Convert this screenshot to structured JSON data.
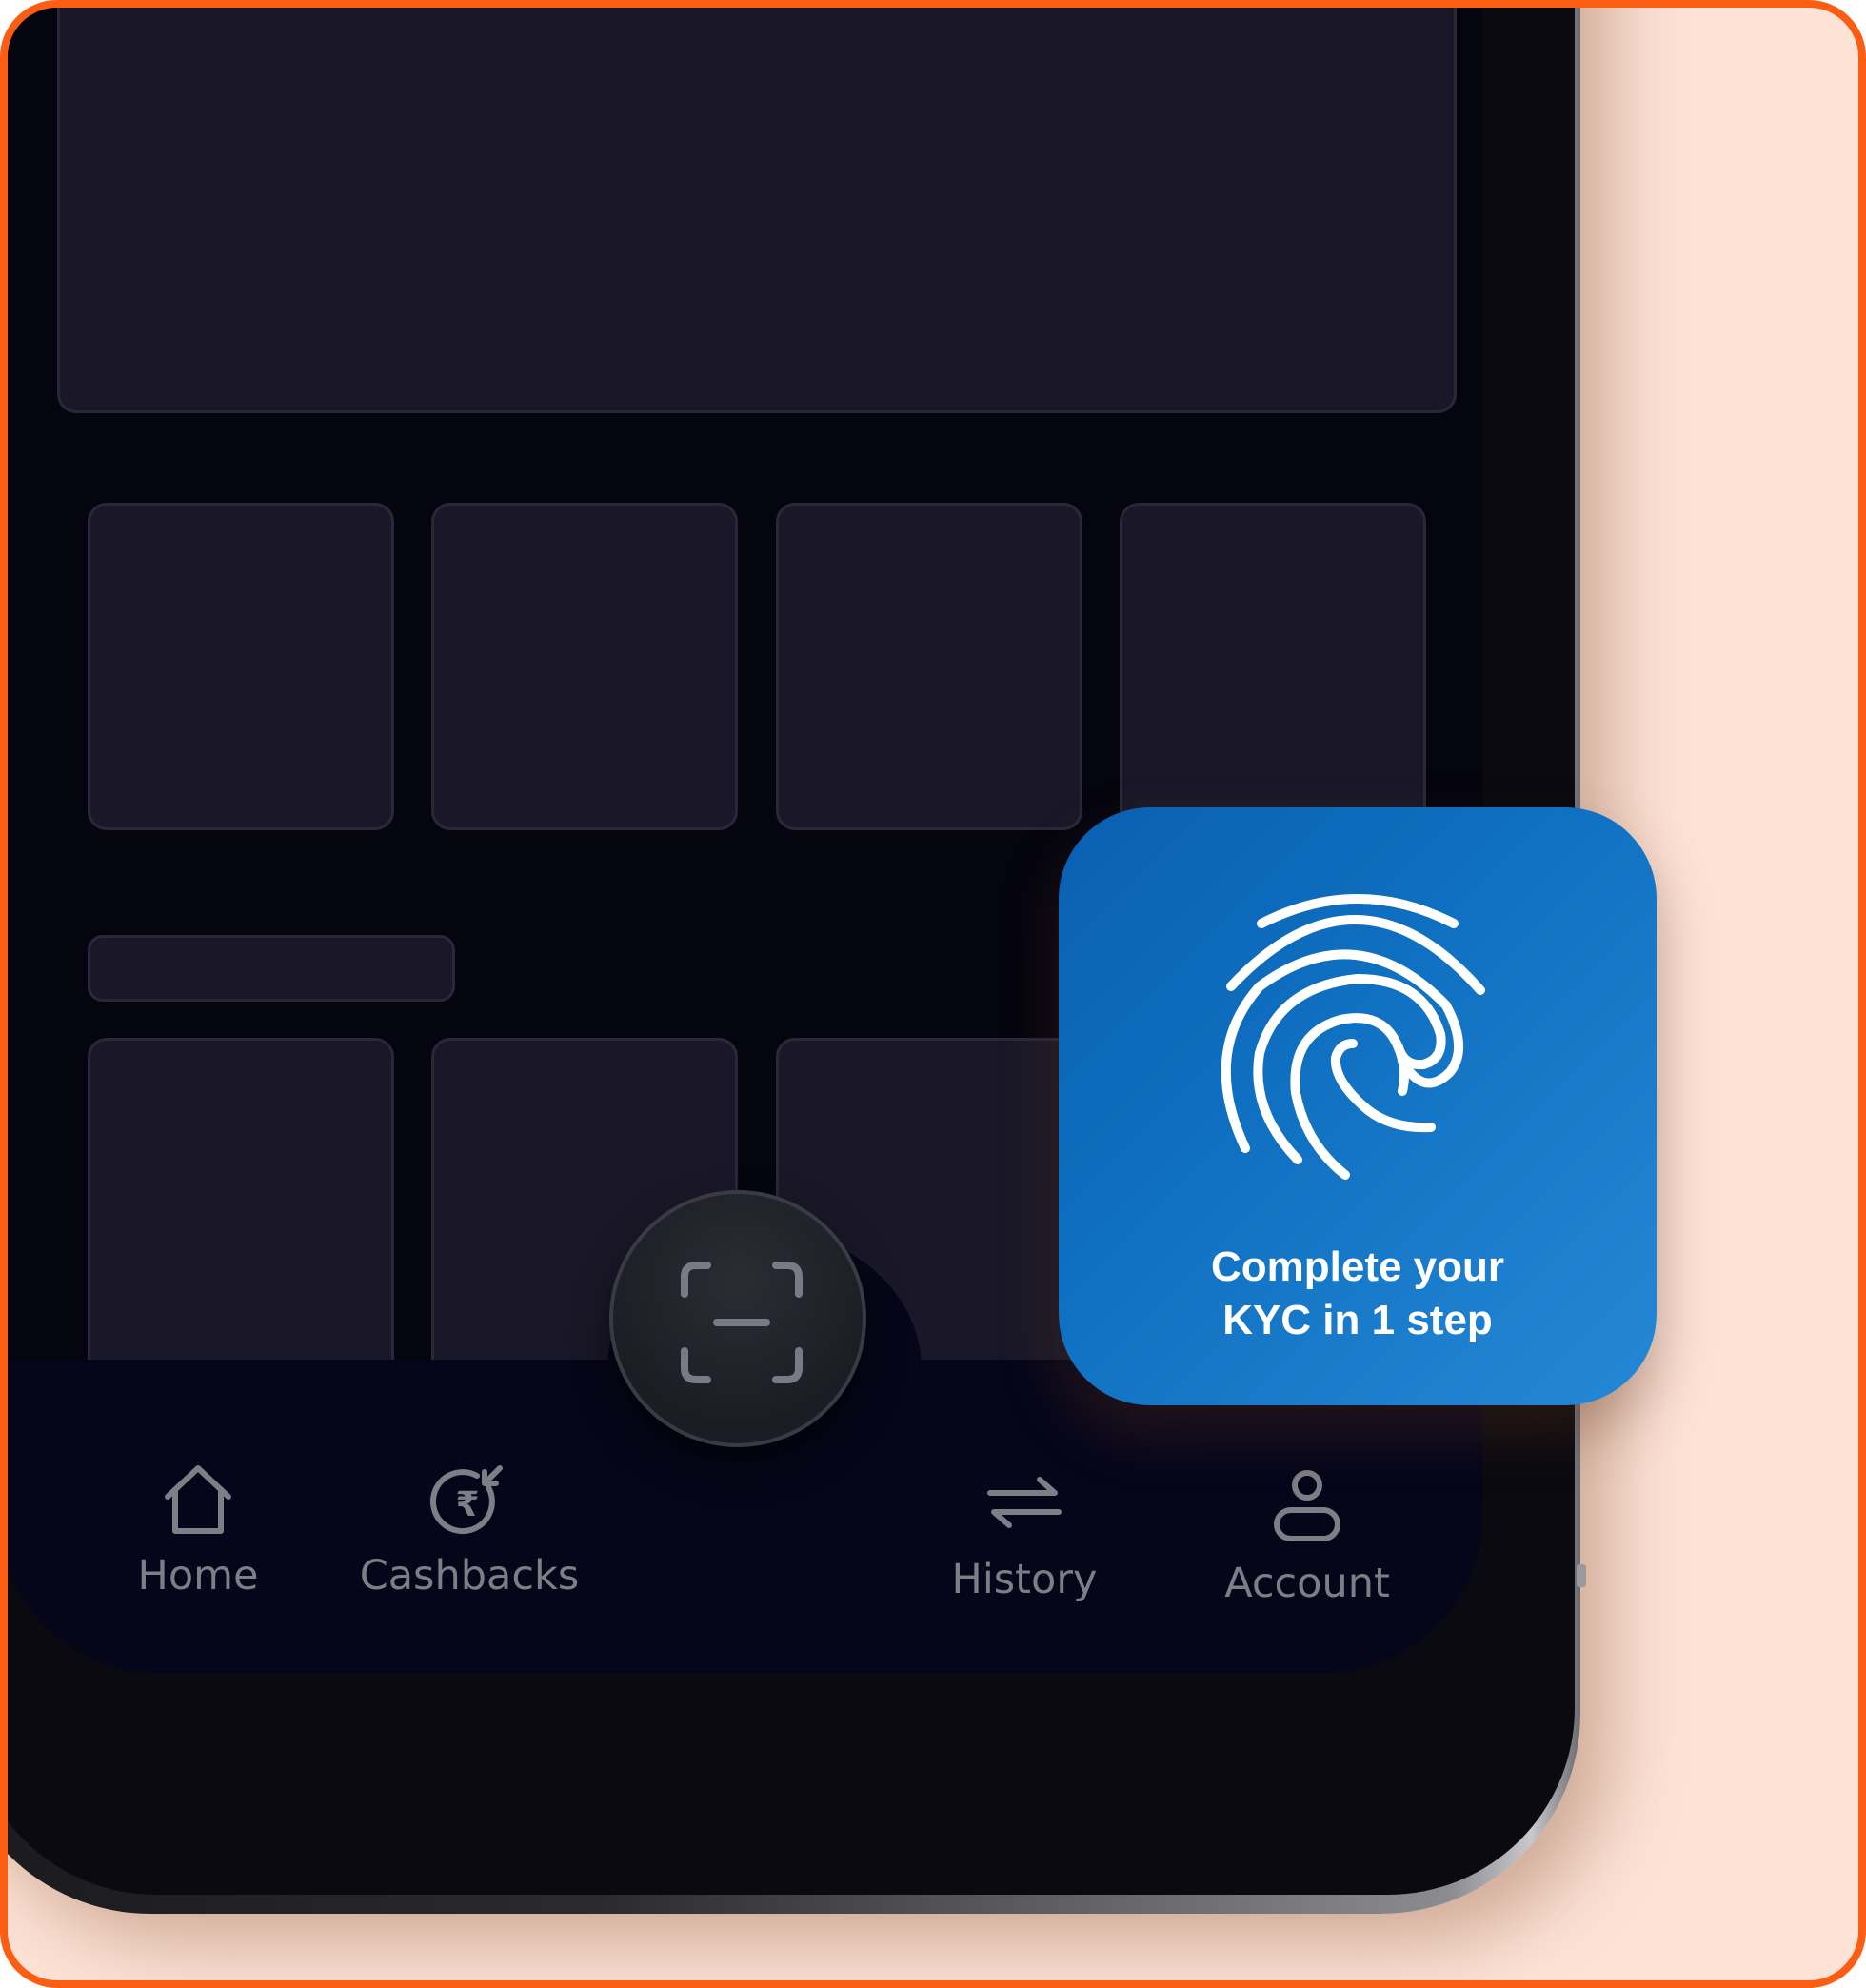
{
  "colors": {
    "frame_border": "#fb5d12",
    "frame_background": "#fde3d6",
    "screen_background": "#05050f",
    "placeholder_fill": "#1a1828",
    "kyc_card_start": "#0a60b2",
    "kyc_card_end": "#2588d6",
    "nav_label": "#7e7e86"
  },
  "kyc_card": {
    "icon": "fingerprint-icon",
    "line1": "Complete your",
    "line2": "KYC in 1 step"
  },
  "scan_button": {
    "icon": "scan-icon"
  },
  "bottom_nav": {
    "items": [
      {
        "label": "Home",
        "icon": "home-icon"
      },
      {
        "label": "Cashbacks",
        "icon": "cashback-rupee-icon"
      },
      {
        "label": "History",
        "icon": "swap-arrows-icon"
      },
      {
        "label": "Account",
        "icon": "user-icon"
      }
    ]
  }
}
